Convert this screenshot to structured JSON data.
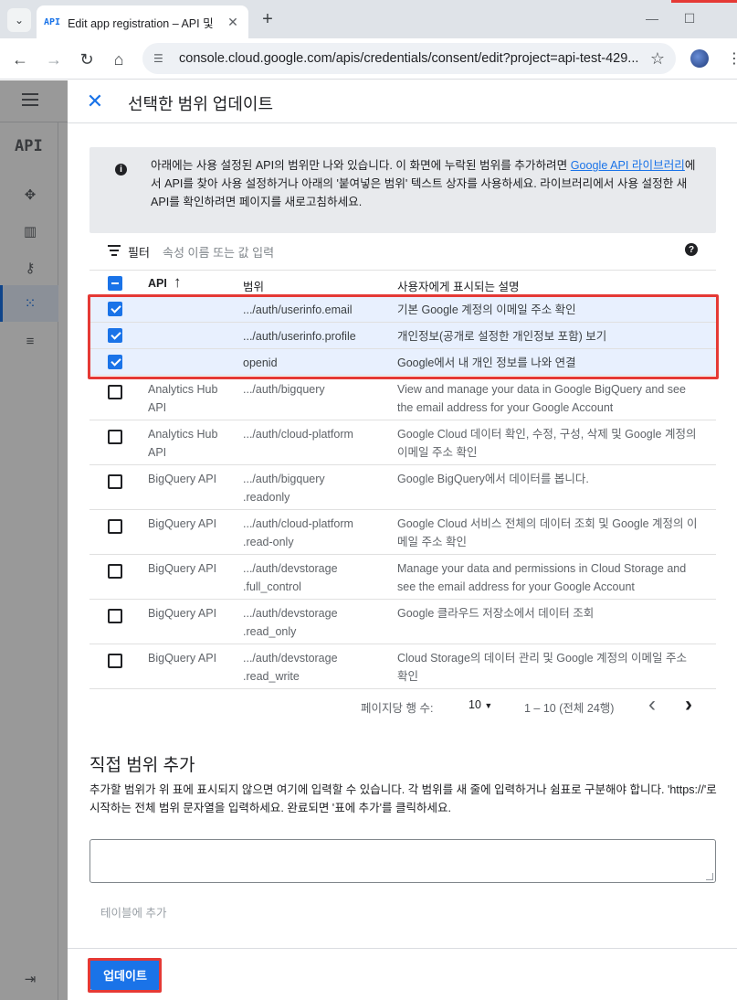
{
  "browser": {
    "tab_list_icon": "chevron-down-icon",
    "tab_favicon": "API",
    "tab_title": "Edit app registration – API 및",
    "tab_close": "✕",
    "new_tab": "+",
    "url": "console.cloud.google.com/apis/credentials/consent/edit?project=api-test-429...",
    "minimize": "—",
    "maximize": "☐"
  },
  "console": {
    "side_api_label": "API"
  },
  "panel": {
    "title": "선택한 범위 업데이트",
    "info_text_before_link": "아래에는 사용 설정된 API의 범위만 나와 있습니다. 이 화면에 누락된 범위를 추가하려면 ",
    "info_link": "Google API 라이브러리",
    "info_text_after_link": "에서 API를 찾아 사용 설정하거나 아래의 '붙여넣은 범위' 텍스트 상자를 사용하세요. 라이브러리에서 사용 설정한 새 API를 확인하려면 페이지를 새로고침하세요.",
    "filter_label": "필터",
    "filter_placeholder": "속성 이름 또는 값 입력",
    "help_icon": "?",
    "columns": {
      "api": "API",
      "sort": "↑",
      "scope": "범위",
      "desc": "사용자에게 표시되는 설명"
    },
    "rows": [
      {
        "api": "",
        "scope": ".../auth/userinfo.email",
        "desc": "기본 Google 계정의 이메일 주소 확인",
        "checked": true
      },
      {
        "api": "",
        "scope": ".../auth/userinfo.profile",
        "desc": "개인정보(공개로 설정한 개인정보 포함) 보기",
        "checked": true
      },
      {
        "api": "",
        "scope": "openid",
        "desc": "Google에서 내 개인 정보를 나와 연결",
        "checked": true
      },
      {
        "api": "Analytics Hub API",
        "scope": ".../auth/bigquery",
        "desc": "View and manage your data in Google BigQuery and see the email address for your Google Account",
        "checked": false
      },
      {
        "api": "Analytics Hub API",
        "scope": ".../auth/cloud-platform",
        "desc": "Google Cloud 데이터 확인, 수정, 구성, 삭제 및 Google 계정의 이메일 주소 확인",
        "checked": false
      },
      {
        "api": "BigQuery API",
        "scope": ".../auth/bigquery .readonly",
        "desc": "Google BigQuery에서 데이터를 봅니다.",
        "checked": false
      },
      {
        "api": "BigQuery API",
        "scope": ".../auth/cloud-platform .read-only",
        "desc": "Google Cloud 서비스 전체의 데이터 조회 및 Google 계정의 이메일 주소 확인",
        "checked": false
      },
      {
        "api": "BigQuery API",
        "scope": ".../auth/devstorage .full_control",
        "desc": "Manage your data and permissions in Cloud Storage and see the email address for your Google Account",
        "checked": false
      },
      {
        "api": "BigQuery API",
        "scope": ".../auth/devstorage .read_only",
        "desc": "Google 클라우드 저장소에서 데이터 조회",
        "checked": false
      },
      {
        "api": "BigQuery API",
        "scope": ".../auth/devstorage .read_write",
        "desc": "Cloud Storage의 데이터 관리 및 Google 계정의 이메일 주소 확인",
        "checked": false
      }
    ],
    "pager": {
      "rows_per_page_label": "페이지당 행 수:",
      "rows_per_page_value": "10",
      "range": "1 – 10 (전체 24행)",
      "prev": "‹",
      "next": "›"
    },
    "manual_title": "직접 범위 추가",
    "manual_desc": "추가할 범위가 위 표에 표시되지 않으면 여기에 입력할 수 있습니다. 각 범위를 새 줄에 입력하거나 쉼표로 구분해야 합니다. 'https://'로 시작하는 전체 범위 문자열을 입력하세요. 완료되면 '표에 추가'를 클릭하세요.",
    "add_to_table": "테이블에 추가",
    "update_button": "업데이트"
  },
  "colors": {
    "accent": "#1a73e8",
    "highlight": "#e53935",
    "selected_row": "#e8f0fe"
  }
}
